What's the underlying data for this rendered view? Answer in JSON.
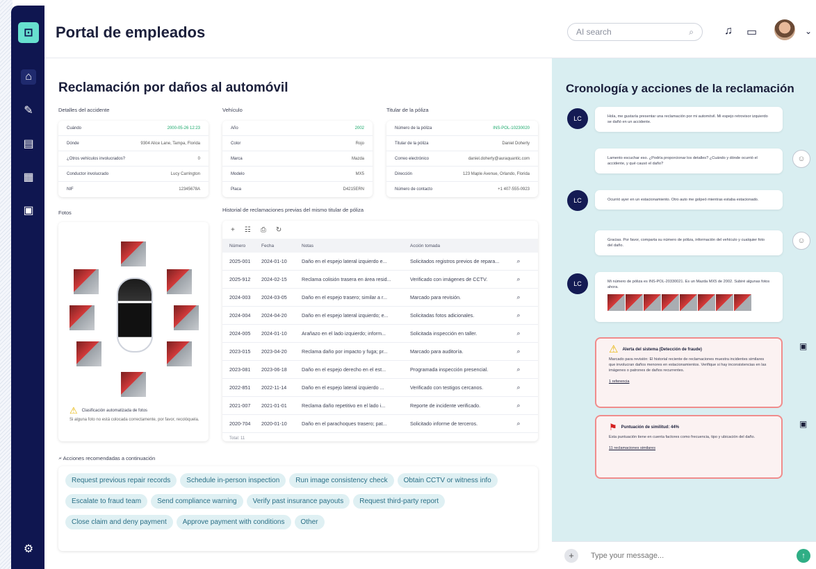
{
  "app": {
    "title": "Portal de empleados",
    "search_placeholder": "AI search"
  },
  "main": {
    "heading": "Reclamación por daños al automóvil",
    "accident": {
      "label": "Detalles del accidente",
      "rows": [
        {
          "k": "Cuándo",
          "v": "2000-05-26 12:23"
        },
        {
          "k": "Dónde",
          "v": "9304 Alice Lane, Tampa, Florida"
        },
        {
          "k": "¿Otros vehículos involucrados?",
          "v": "0"
        },
        {
          "k": "Conductor involucrado",
          "v": "Lucy Carrington"
        },
        {
          "k": "NIF",
          "v": "12345678A"
        }
      ]
    },
    "vehicle": {
      "label": "Vehículo",
      "rows": [
        {
          "k": "Año",
          "v": "2002"
        },
        {
          "k": "Color",
          "v": "Rojo"
        },
        {
          "k": "Marca",
          "v": "Mazda"
        },
        {
          "k": "Modelo",
          "v": "MX5"
        },
        {
          "k": "Placa",
          "v": "D4215ERN"
        }
      ]
    },
    "holder": {
      "label": "Titular de la póliza",
      "rows": [
        {
          "k": "Número de la póliza",
          "v": "INS-POL-10230020"
        },
        {
          "k": "Titular de la póliza",
          "v": "Daniel Doherty"
        },
        {
          "k": "Correo electrónico",
          "v": "daniel.doherty@auraquantic.com"
        },
        {
          "k": "Dirección",
          "v": "123 Maple Avenue, Orlando, Florida"
        },
        {
          "k": "Número de contacto",
          "v": "+1 407-555-0923"
        }
      ]
    },
    "photos": {
      "label": "Fotos",
      "note_title": "Clasificación automatizada de fotos",
      "note_text": "Si alguna foto no está colocada correctamente, por favor, recolóquela."
    },
    "history": {
      "label": "Historial de reclamaciones previas del mismo titular de póliza",
      "headers": [
        "Número",
        "Fecha",
        "Notas",
        "Acción tomada"
      ],
      "total": "Total: 11",
      "rows": [
        [
          "2025-001",
          "2024-01-10",
          "Daño en el espejo lateral izquierdo e...",
          "Solicitados registros previos de repara..."
        ],
        [
          "2025-912",
          "2024-02-15",
          "Reclama colisión trasera en área resid...",
          "Verificado con imágenes de CCTV."
        ],
        [
          "2024-003",
          "2024-03-05",
          "Daño en el espejo trasero; similar a r...",
          "Marcado para revisión."
        ],
        [
          "2024-004",
          "2024-04-20",
          "Daño en el espejo lateral izquierdo; e...",
          "Solicitadas fotos adicionales."
        ],
        [
          "2024-005",
          "2024-01-10",
          "Arañazo en el lado izquierdo; inform...",
          "Solicitada inspección en taller."
        ],
        [
          "2023-015",
          "2023-04-20",
          "Reclama daño por impacto y fuga; pr...",
          "Marcado para auditoría."
        ],
        [
          "2023-081",
          "2023-06-18",
          "Daño en el espejo derecho en el est...",
          "Programada inspección presencial."
        ],
        [
          "2022-851",
          "2022-11-14",
          "Daño en el espejo lateral izquierdo ...",
          "Verificado con testigos cercanos."
        ],
        [
          "2021-007",
          "2021-01-01",
          "Reclama daño repetitivo en el lado i...",
          "Reporte de incidente verificado."
        ],
        [
          "2020-704",
          "2020-01-10",
          "Daño en el parachoques trasero; pat...",
          "Solicitado informe de terceros."
        ]
      ]
    },
    "actions": {
      "label": "Acciones recomendadas a continuación",
      "chips": [
        [
          "Request previous repair records",
          "Schedule in-person inspection",
          "Run image consistency check",
          "Obtain CCTV or witness info"
        ],
        [
          "Escalate to fraud team",
          "Send compliance warning",
          "Verify past insurance payouts",
          "Request third-party report"
        ],
        [
          "Close claim and deny payment",
          "Approve payment with conditions",
          "Other"
        ]
      ]
    }
  },
  "timeline": {
    "heading": "Cronología y acciones de la reclamación",
    "initials": "LC",
    "m1": "Hola, me gustaría presentar una reclamación por mi automóvil. Mi espejo retrovisor izquierdo se dañó en un accidente.",
    "m2": "Lamento escuchar eso. ¿Podría proporcionar los detalles? ¿Cuándo y dónde ocurrió el accidente, y qué causó el daño?",
    "m3": "Ocurrió ayer en un estacionamiento. Otro auto me golpeó mientras estaba estacionado.",
    "m4": "Gracias. Por favor, comparta su número de póliza, información del vehículo y cualquier foto del daño.",
    "m5": "Mi número de póliza es INS-POL-20330021. Es un Mazda MX5 de 2002. Subiré algunas fotos ahora.",
    "alert1": {
      "title": "Alerta del sistema (Detección de fraude)",
      "text": "Marcado para revisión: El historial reciente de reclamaciones muestra incidentes similares que involucran daños menores en estacionamientos. Verifique si hay inconsistencias en las imágenes o patrones de daños recurrentes.",
      "link": "1 referencia"
    },
    "alert2": {
      "title": "Puntuación de similitud: 44%",
      "text": "Esta puntuación tiene en cuenta factores como frecuencia, tipo y ubicación del daño.",
      "link": "11 reclamaciones similares"
    },
    "input_placeholder": "Type your message..."
  }
}
